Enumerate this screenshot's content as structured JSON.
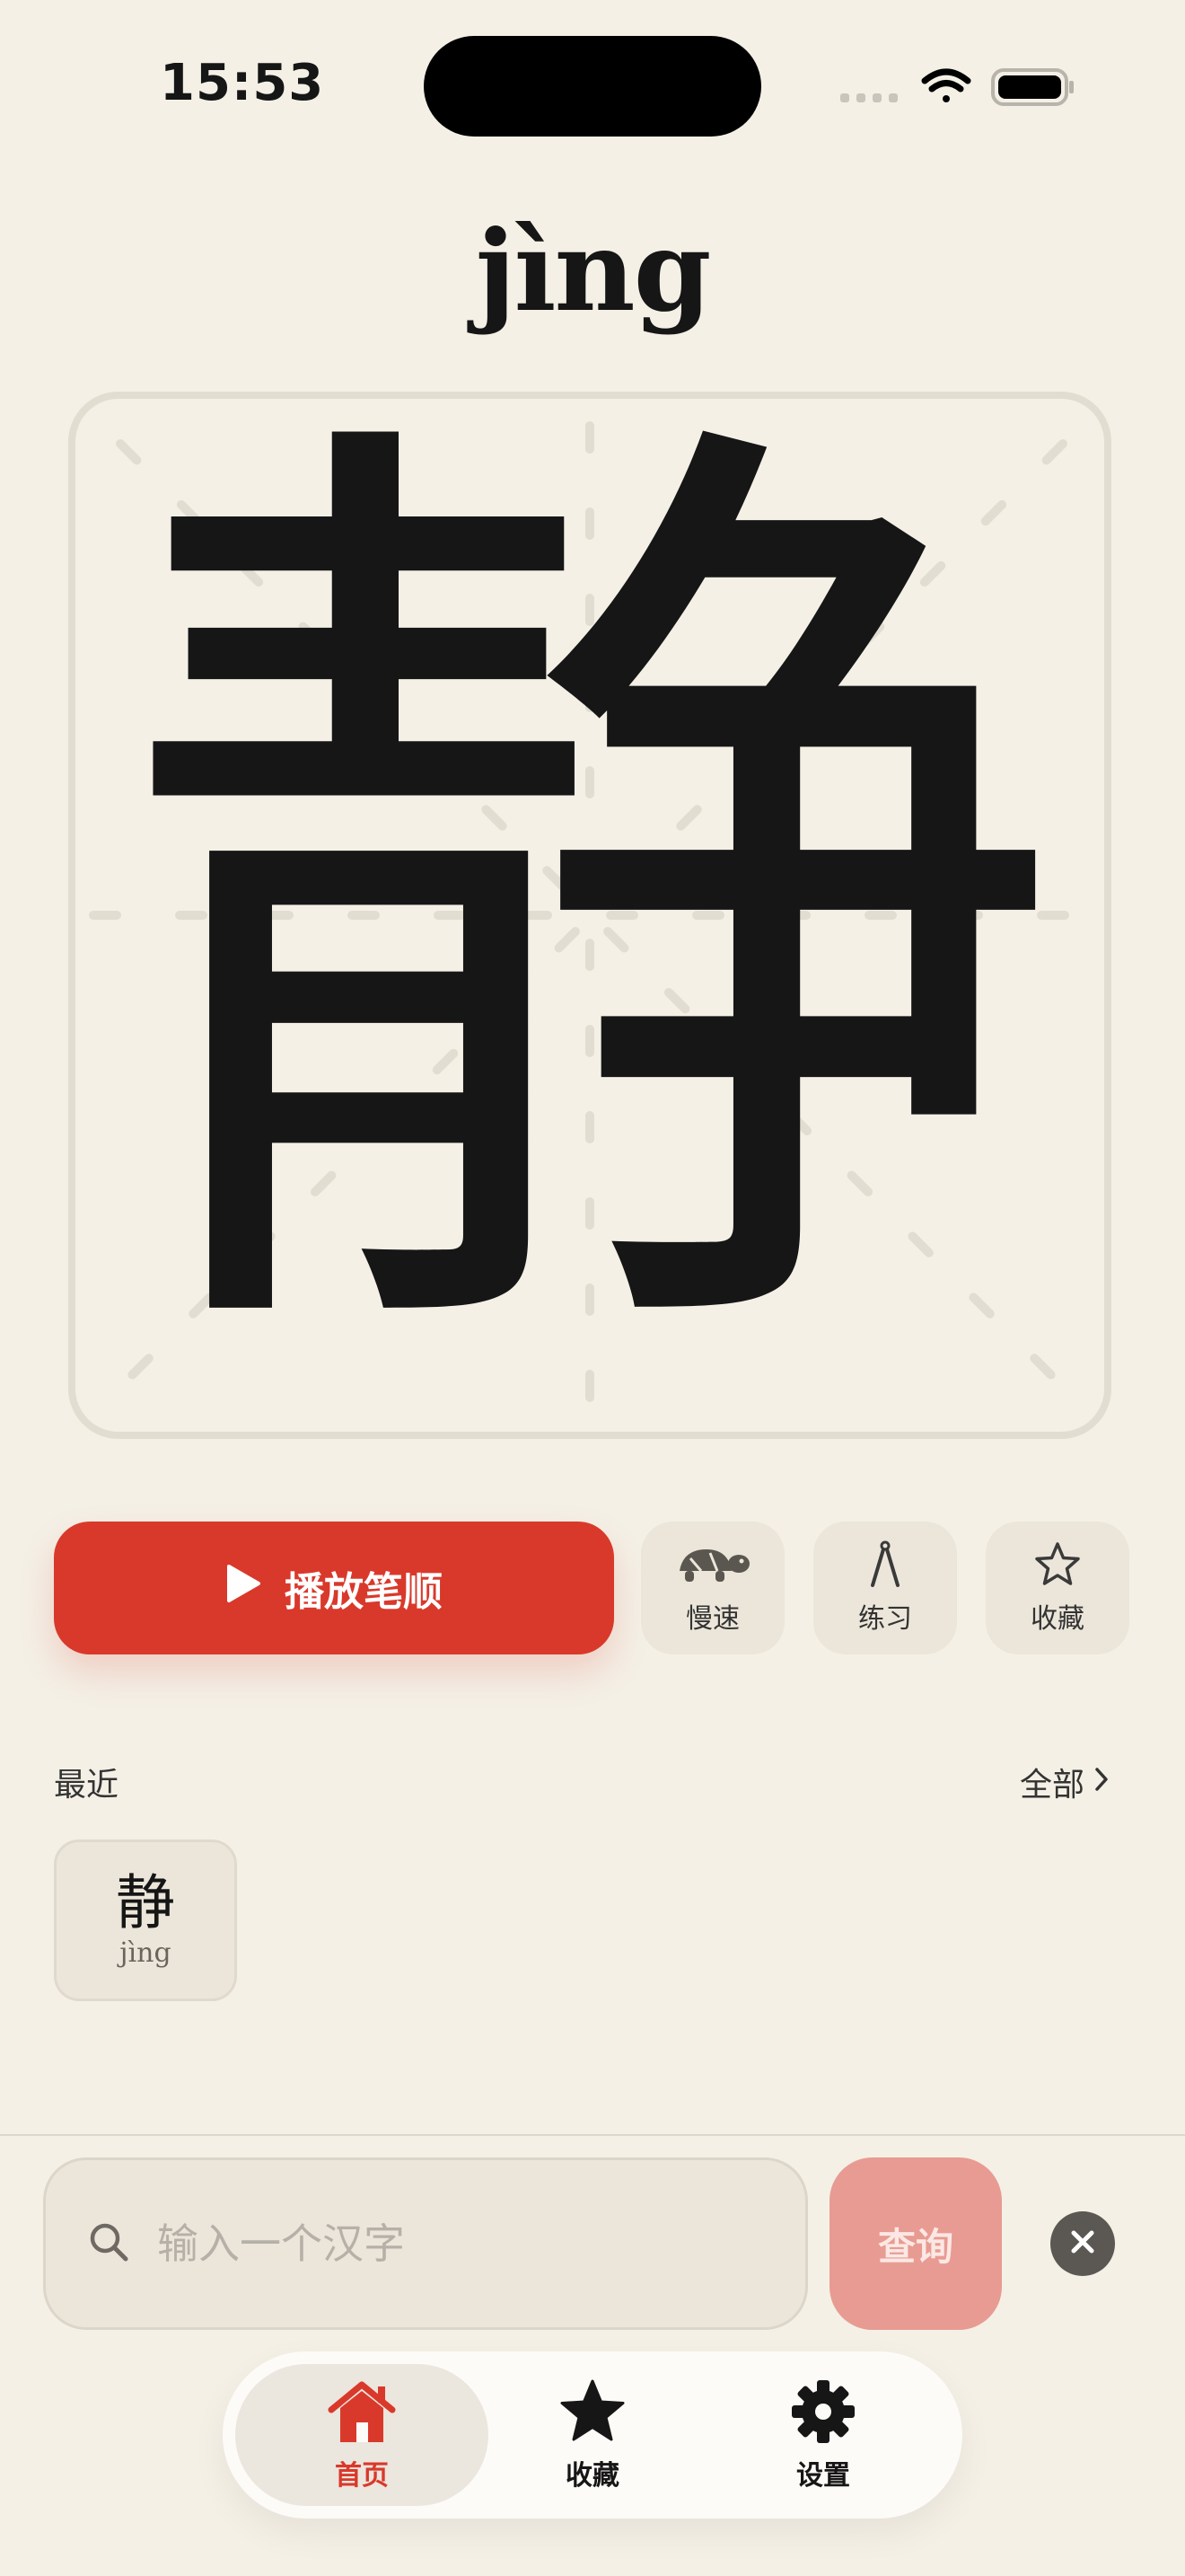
{
  "status": {
    "time": "15:53"
  },
  "character": {
    "hanzi": "静",
    "pinyin": "jìng"
  },
  "controls": {
    "play_label": "播放笔顺",
    "slow_label": "慢速",
    "practice_label": "练习",
    "favorite_label": "收藏"
  },
  "recent": {
    "title": "最近",
    "all_label": "全部",
    "items": [
      {
        "hanzi": "静",
        "pinyin": "jìng"
      }
    ]
  },
  "search": {
    "placeholder": "输入一个汉字",
    "query_label": "查询"
  },
  "tabs": [
    {
      "label": "首页",
      "icon": "home-icon",
      "active": true
    },
    {
      "label": "收藏",
      "icon": "star-icon",
      "active": false
    },
    {
      "label": "设置",
      "icon": "gear-icon",
      "active": false
    }
  ],
  "colors": {
    "accent": "#d9392b",
    "background": "#f4f0e6",
    "grid_line": "#e2ddd1"
  }
}
